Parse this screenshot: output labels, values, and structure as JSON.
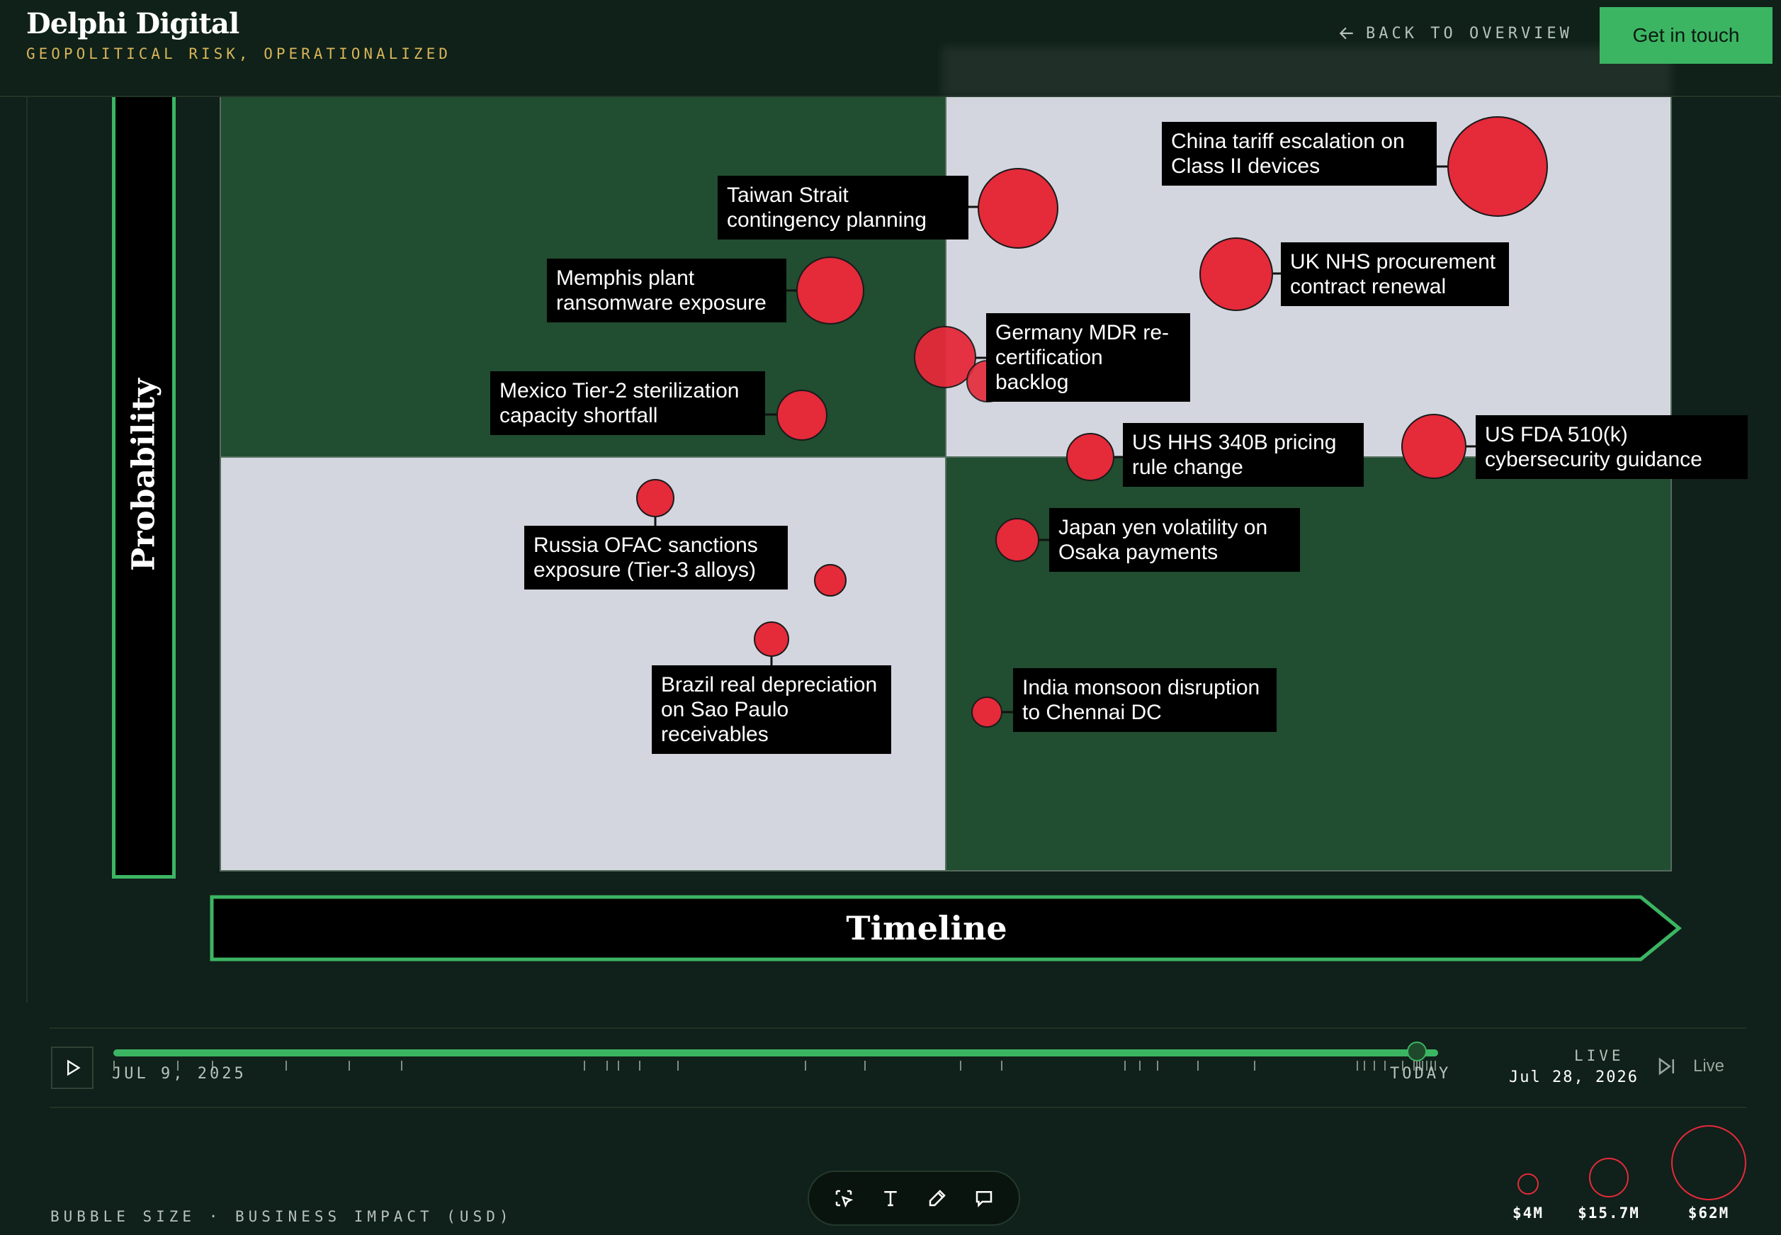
{
  "header": {
    "brand": "Delphi Digital",
    "tagline": "GEOPOLITICAL RISK, OPERATIONALIZED",
    "back_label": "BACK TO OVERVIEW",
    "cta_label": "Get in touch"
  },
  "matrix": {
    "y_axis_label": "Probability",
    "x_axis_label": "Timeline"
  },
  "risks": [
    {
      "id": "china",
      "label": "China tariff escalation on Class II devices"
    },
    {
      "id": "taiwan",
      "label": "Taiwan Strait contingency planning"
    },
    {
      "id": "uk",
      "label": "UK NHS procurement contract renewal"
    },
    {
      "id": "memphis",
      "label": "Memphis plant ransomware exposure"
    },
    {
      "id": "germany",
      "label": "Germany MDR re-certification backlog"
    },
    {
      "id": "mexico",
      "label": "Mexico Tier-2 sterilization capacity shortfall"
    },
    {
      "id": "hhs",
      "label": "US HHS 340B pricing rule change"
    },
    {
      "id": "fda",
      "label": "US FDA 510(k) cybersecurity guidance"
    },
    {
      "id": "russia",
      "label": "Russia OFAC sanctions exposure (Tier-3 alloys)"
    },
    {
      "id": "japan",
      "label": "Japan yen volatility on Osaka payments"
    },
    {
      "id": "brazil",
      "label": "Brazil real depreciation on Sao Paulo receivables"
    },
    {
      "id": "india",
      "label": "India monsoon disruption to Chennai DC"
    }
  ],
  "playback": {
    "start_date": "JUL 9, 2025",
    "end_label": "TODAY",
    "progress": 1.0,
    "live_caption": "LIVE",
    "live_date": "Jul 28, 2026",
    "live_button": "Live"
  },
  "legend": {
    "caption": "BUBBLE SIZE · BUSINESS IMPACT (USD)",
    "items": [
      {
        "label": "$4M"
      },
      {
        "label": "$15.7M"
      },
      {
        "label": "$62M"
      }
    ]
  },
  "toolbar": {
    "icons": [
      "select-icon",
      "text-icon",
      "pen-icon",
      "comment-icon"
    ]
  },
  "colors": {
    "accent": "#3cb563",
    "bubble": "#e52a3a",
    "quadrant_dark": "#214d30",
    "quadrant_light": "#d4d6df",
    "brand_gold": "#d8b45a"
  }
}
